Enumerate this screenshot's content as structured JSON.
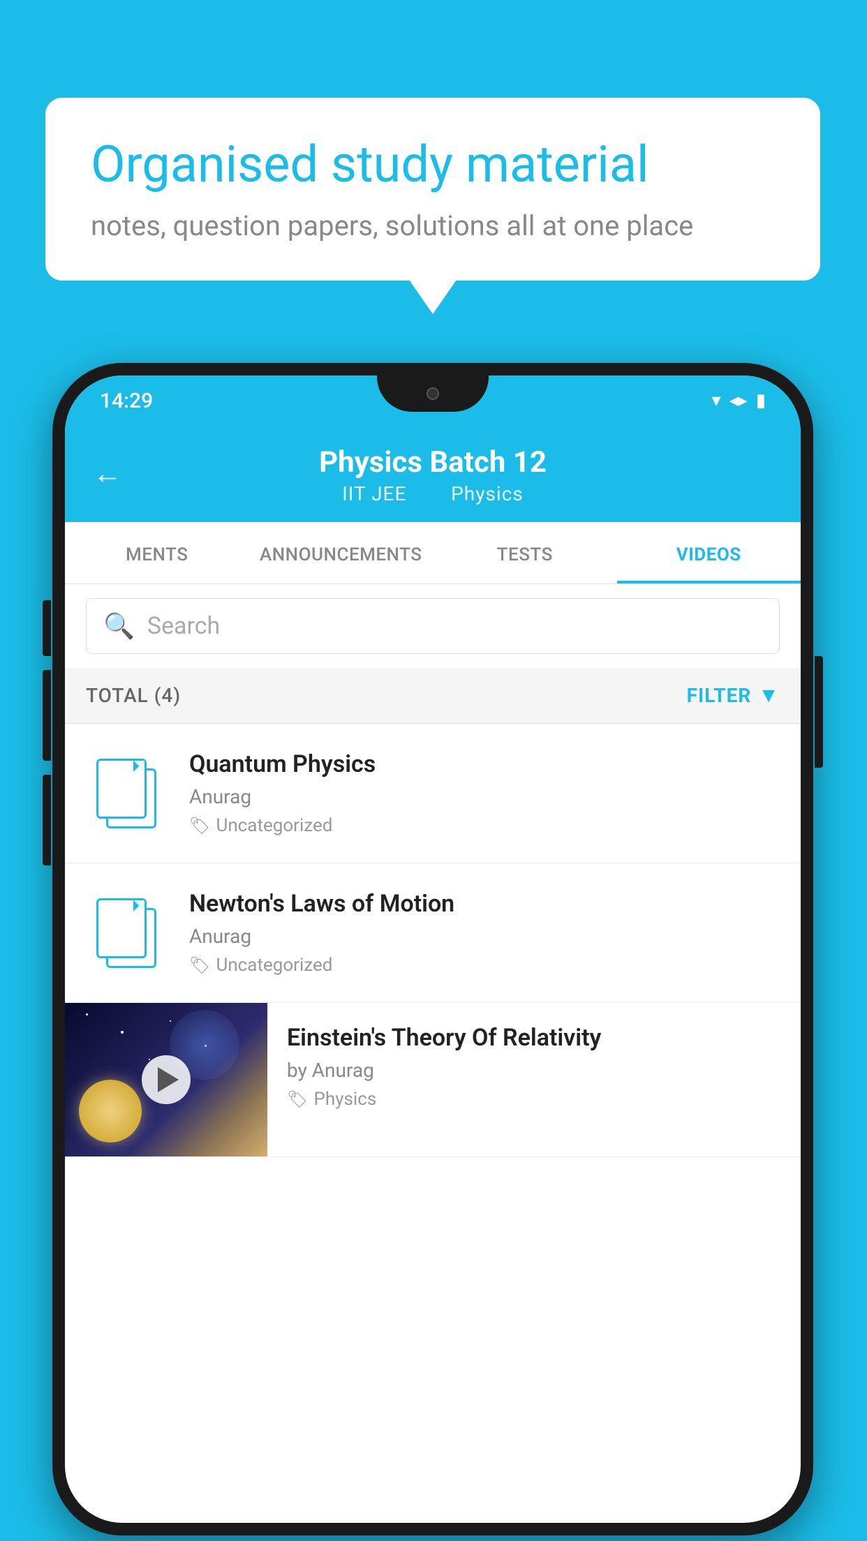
{
  "page": {
    "background_color": "#1BBDE8"
  },
  "speech_bubble": {
    "heading": "Organised study material",
    "subtext": "notes, question papers, solutions all at one place"
  },
  "status_bar": {
    "time": "14:29"
  },
  "app_header": {
    "back_label": "←",
    "title": "Physics Batch 12",
    "subtitle_part1": "IIT JEE",
    "subtitle_part2": "Physics"
  },
  "tabs": [
    {
      "label": "MENTS",
      "active": false
    },
    {
      "label": "ANNOUNCEMENTS",
      "active": false
    },
    {
      "label": "TESTS",
      "active": false
    },
    {
      "label": "VIDEOS",
      "active": true
    }
  ],
  "search": {
    "placeholder": "Search"
  },
  "filter_row": {
    "total_label": "TOTAL (4)",
    "filter_label": "FILTER"
  },
  "videos": [
    {
      "id": 1,
      "title": "Quantum Physics",
      "author": "Anurag",
      "tag": "Uncategorized",
      "has_thumbnail": false
    },
    {
      "id": 2,
      "title": "Newton's Laws of Motion",
      "author": "Anurag",
      "tag": "Uncategorized",
      "has_thumbnail": false
    },
    {
      "id": 3,
      "title": "Einstein's Theory Of Relativity",
      "author": "by Anurag",
      "tag": "Physics",
      "has_thumbnail": true
    }
  ]
}
